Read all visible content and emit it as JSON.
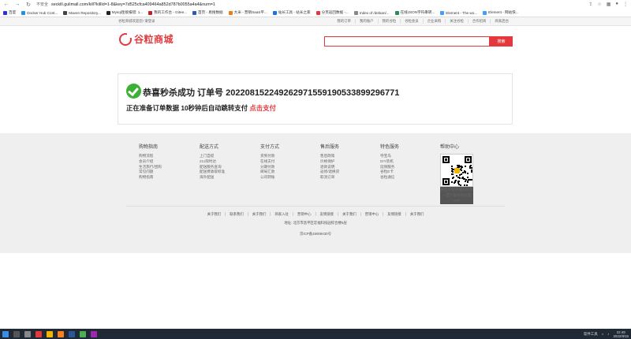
{
  "browser": {
    "secure_label": "不安全",
    "url": "seckill.gulimall.com/kill?killId=1-8&key=7d525cfca409464a852d787b0055a4a4&num=1",
    "bookmarks": [
      {
        "label": "百度",
        "color": "#2932e1"
      },
      {
        "label": "Docker Hub Cont...",
        "color": "#1d91e6"
      },
      {
        "label": "Maven Repository...",
        "color": "#444444"
      },
      {
        "label": "Mysql连接报错: 1...",
        "color": "#222222"
      },
      {
        "label": "我的工作台 - Gitee...",
        "color": "#c71d23"
      },
      {
        "label": "首页 - 易搜数据",
        "color": "#2b5ab8"
      },
      {
        "label": "大米 - 营销SaaS平...",
        "color": "#f07a13"
      },
      {
        "label": "站长工具 - 站长之家",
        "color": "#1a73e8"
      },
      {
        "label": "分页返回数据 -...",
        "color": "#e4393c"
      },
      {
        "label": "Index of /debian/...",
        "color": "#888888"
      },
      {
        "label": "在线JSON字符串转...",
        "color": "#2e8b57"
      },
      {
        "label": "Element - The wo...",
        "color": "#409eff"
      },
      {
        "label": "Element - 网站快...",
        "color": "#409eff"
      }
    ]
  },
  "topbar": {
    "welcome": "谷粒商城欢迎您! 请登录",
    "links": [
      "我的订单",
      "我的账户",
      "我的谷粒",
      "谷粒会员",
      "企业采购",
      "关注谷粒",
      "合作招商",
      "商家后台"
    ]
  },
  "header": {
    "logo_text": "谷粒商城",
    "search_placeholder": "",
    "search_button": "搜索"
  },
  "result": {
    "title": "恭喜秒杀成功 订单号 202208152249262971559190533899296771",
    "subtitle": "正在准备订单数据 10秒钟后自动跳转支付",
    "pay_link": "点击支付"
  },
  "footer": {
    "columns": [
      {
        "title": "购物指南",
        "items": [
          "购物流程",
          "会员介绍",
          "生活旅行/团购",
          "常见问题",
          "购物指南"
        ]
      },
      {
        "title": "配送方式",
        "items": [
          "上门自提",
          "211限时达",
          "配送服务查询",
          "配送费收取标准",
          "海外配送"
        ]
      },
      {
        "title": "支付方式",
        "items": [
          "货到付款",
          "在线支付",
          "分期付款",
          "邮局汇款",
          "公司转账"
        ]
      },
      {
        "title": "售后服务",
        "items": [
          "售后政策",
          "价格保护",
          "退款说明",
          "返修/退换货",
          "取消订单"
        ]
      },
      {
        "title": "特色服务",
        "items": [
          "夺宝岛",
          "DIY装机",
          "延保服务",
          "谷粒E卡",
          "谷粒通信"
        ]
      }
    ],
    "help_title": "帮助中心",
    "qr_caption": "关注谷粒商城公众号 一键下载谷粒商城APP",
    "links": [
      "关于我们",
      "联系我们",
      "关于我们",
      "商家入驻",
      "营销中心",
      "友情链接",
      "关于我们",
      "营销中心",
      "友情链接",
      "关于我们"
    ],
    "address": "地址: 北京市昌平区宏福科技园综合楼6层",
    "icp": "京ICP备19009430号"
  },
  "taskbar": {
    "tray_label": "软件工具",
    "time": "22:49",
    "date": "2022/8/15"
  }
}
